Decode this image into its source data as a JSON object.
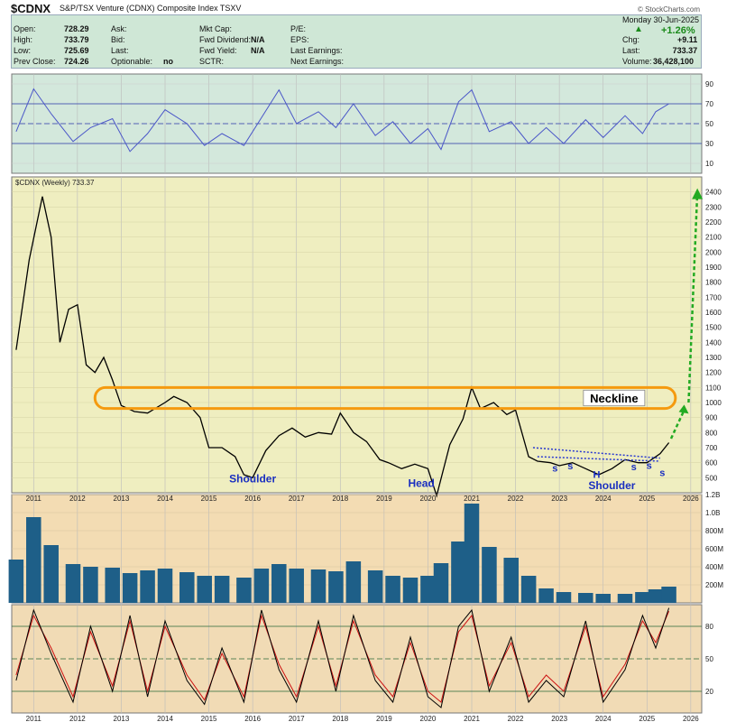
{
  "header": {
    "symbol": "$CDNX",
    "name": "S&P/TSX Venture (CDNX) Composite Index  TSXV",
    "watermark": "© StockCharts.com",
    "date": "Monday  30-Jun-2025"
  },
  "quote": {
    "left": [
      [
        "Open:",
        "728.29"
      ],
      [
        "High:",
        "733.79"
      ],
      [
        "Low:",
        "725.69"
      ],
      [
        "Prev Close:",
        "724.26"
      ]
    ],
    "mid": [
      [
        "Ask:",
        ""
      ],
      [
        "Bid:",
        ""
      ],
      [
        "Last:",
        ""
      ],
      [
        "Optionable:",
        "no"
      ]
    ],
    "mid2": [
      [
        "Mkt Cap:",
        ""
      ],
      [
        "Fwd Dividend:",
        "N/A"
      ],
      [
        "Fwd Yield:",
        "N/A"
      ],
      [
        "SCTR:",
        ""
      ]
    ],
    "mid3": [
      "P/E:",
      "EPS:",
      "Last Earnings:",
      "Next Earnings:"
    ],
    "change_pct": "+1.26%",
    "right": [
      [
        "Chg:",
        "+9.11"
      ],
      [
        "Last:",
        "733.37"
      ],
      [
        "Volume:",
        "36,428,100"
      ]
    ]
  },
  "colors": {
    "rsi_bg": "#d3e8dc",
    "price_bg": "#efeec0",
    "volume_bg": "#f3dcb3",
    "stoch_bg": "#f1dbb5",
    "price_line": "#000000",
    "rsi_line": "#4a56c8",
    "volume_bar": "#1e5f88",
    "stoch_k": "#000000",
    "stoch_d": "#cc1111",
    "neckline": "#f59a0f",
    "projection": "#22aa22",
    "trendline": "#2a3ad0",
    "annotation_text": "#1a2fc0"
  },
  "chart_data": [
    {
      "type": "line",
      "panel": "RSI",
      "ylim": [
        0,
        100
      ],
      "ticks": [
        10,
        30,
        50,
        70,
        90
      ],
      "reference_lines": [
        30,
        50,
        70
      ],
      "x": [
        2010.6,
        2011.0,
        2011.4,
        2011.9,
        2012.3,
        2012.8,
        2013.2,
        2013.6,
        2014.0,
        2014.5,
        2014.9,
        2015.3,
        2015.8,
        2016.2,
        2016.6,
        2017.0,
        2017.5,
        2017.9,
        2018.3,
        2018.8,
        2019.2,
        2019.6,
        2020.0,
        2020.3,
        2020.7,
        2021.0,
        2021.4,
        2021.9,
        2022.3,
        2022.7,
        2023.1,
        2023.6,
        2024.0,
        2024.5,
        2024.9,
        2025.2,
        2025.5
      ],
      "values": [
        42,
        85,
        60,
        32,
        46,
        55,
        22,
        40,
        64,
        50,
        28,
        40,
        28,
        56,
        84,
        50,
        62,
        46,
        70,
        38,
        52,
        30,
        45,
        24,
        72,
        84,
        42,
        52,
        30,
        46,
        30,
        54,
        36,
        58,
        40,
        62,
        70
      ]
    },
    {
      "type": "line",
      "panel": "Price",
      "title": "$CDNX (Weekly) 733.37",
      "ylim": [
        400,
        2500
      ],
      "ticks": [
        500,
        600,
        700,
        800,
        900,
        1000,
        1100,
        1200,
        1300,
        1400,
        1500,
        1600,
        1700,
        1800,
        1900,
        2000,
        2100,
        2200,
        2300,
        2400
      ],
      "xlabels": [
        "2011",
        "2012",
        "2013",
        "2014",
        "2015",
        "2016",
        "2017",
        "2018",
        "2019",
        "2020",
        "2021",
        "2022",
        "2023",
        "2024",
        "2025",
        "2026"
      ],
      "x": [
        2010.6,
        2010.9,
        2011.2,
        2011.4,
        2011.6,
        2011.8,
        2012.0,
        2012.2,
        2012.4,
        2012.6,
        2012.8,
        2013.0,
        2013.3,
        2013.6,
        2014.0,
        2014.2,
        2014.5,
        2014.8,
        2015.0,
        2015.3,
        2015.6,
        2015.8,
        2016.0,
        2016.3,
        2016.6,
        2016.9,
        2017.2,
        2017.5,
        2017.8,
        2018.0,
        2018.3,
        2018.6,
        2018.9,
        2019.1,
        2019.4,
        2019.7,
        2020.0,
        2020.2,
        2020.5,
        2020.8,
        2021.0,
        2021.2,
        2021.5,
        2021.8,
        2022.0,
        2022.3,
        2022.5,
        2022.8,
        2023.0,
        2023.3,
        2023.6,
        2023.9,
        2024.2,
        2024.5,
        2024.8,
        2025.0,
        2025.3,
        2025.5
      ],
      "values": [
        1350,
        1950,
        2370,
        2100,
        1400,
        1620,
        1650,
        1250,
        1200,
        1300,
        1150,
        980,
        940,
        930,
        1000,
        1040,
        1000,
        900,
        700,
        700,
        640,
        520,
        500,
        680,
        780,
        830,
        770,
        800,
        790,
        930,
        800,
        740,
        620,
        600,
        560,
        590,
        560,
        380,
        720,
        890,
        1100,
        960,
        1000,
        920,
        950,
        640,
        610,
        600,
        580,
        600,
        560,
        520,
        560,
        620,
        600,
        600,
        660,
        733
      ]
    },
    {
      "type": "bar",
      "panel": "Volume",
      "ylim": [
        0,
        1200
      ],
      "ticks": [
        200,
        400,
        600,
        800,
        1000,
        1200
      ],
      "tick_labels": [
        "200M",
        "400M",
        "600M",
        "800M",
        "1.0B",
        "1.2B"
      ],
      "x": [
        2010.6,
        2011.0,
        2011.4,
        2011.9,
        2012.3,
        2012.8,
        2013.2,
        2013.6,
        2014.0,
        2014.5,
        2014.9,
        2015.3,
        2015.8,
        2016.2,
        2016.6,
        2017.0,
        2017.5,
        2017.9,
        2018.3,
        2018.8,
        2019.2,
        2019.6,
        2020.0,
        2020.3,
        2020.7,
        2021.0,
        2021.4,
        2021.9,
        2022.3,
        2022.7,
        2023.1,
        2023.6,
        2024.0,
        2024.5,
        2024.9,
        2025.2,
        2025.5
      ],
      "values": [
        480,
        950,
        640,
        430,
        400,
        390,
        330,
        360,
        380,
        340,
        300,
        300,
        280,
        380,
        430,
        380,
        370,
        350,
        460,
        360,
        300,
        280,
        300,
        440,
        680,
        1100,
        620,
        500,
        300,
        160,
        120,
        110,
        100,
        100,
        120,
        150,
        180
      ]
    },
    {
      "type": "line",
      "panel": "Stochastic",
      "ylim": [
        0,
        100
      ],
      "ticks": [
        20,
        50,
        80
      ],
      "reference_lines": [
        20,
        50,
        80
      ],
      "x": [
        2010.6,
        2011.0,
        2011.4,
        2011.9,
        2012.3,
        2012.8,
        2013.2,
        2013.6,
        2014.0,
        2014.5,
        2014.9,
        2015.3,
        2015.8,
        2016.2,
        2016.6,
        2017.0,
        2017.5,
        2017.9,
        2018.3,
        2018.8,
        2019.2,
        2019.6,
        2020.0,
        2020.3,
        2020.7,
        2021.0,
        2021.4,
        2021.9,
        2022.3,
        2022.7,
        2023.1,
        2023.6,
        2024.0,
        2024.5,
        2024.9,
        2025.2,
        2025.5
      ],
      "series": [
        {
          "values": [
            30,
            95,
            55,
            10,
            80,
            20,
            90,
            15,
            85,
            30,
            8,
            60,
            10,
            95,
            40,
            10,
            85,
            20,
            90,
            30,
            10,
            70,
            15,
            5,
            80,
            95,
            20,
            70,
            10,
            30,
            15,
            85,
            10,
            40,
            90,
            60,
            97
          ]
        },
        {
          "values": [
            35,
            90,
            60,
            15,
            75,
            25,
            85,
            20,
            80,
            35,
            12,
            55,
            15,
            90,
            45,
            15,
            80,
            25,
            85,
            35,
            15,
            65,
            20,
            10,
            75,
            90,
            25,
            65,
            15,
            35,
            20,
            80,
            15,
            45,
            85,
            65,
            94
          ]
        }
      ]
    }
  ],
  "annotations": {
    "neckline": "Neckline",
    "neckline_level": [
      960,
      1100
    ],
    "left_shoulder": "Shoulder",
    "head": "Head",
    "right_shoulder": "Shoulder",
    "small_s": [
      "s",
      "s",
      "H",
      "s",
      "s",
      "s"
    ],
    "projection_target": 2400
  }
}
